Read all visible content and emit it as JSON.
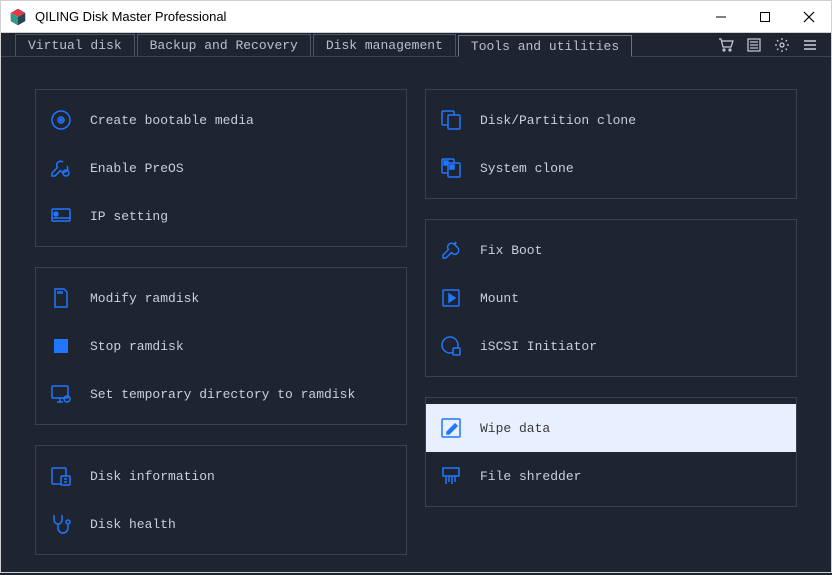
{
  "window": {
    "title": "QILING Disk Master Professional"
  },
  "tabs": {
    "virtual_disk": "Virtual disk",
    "backup_recovery": "Backup and Recovery",
    "disk_management": "Disk management",
    "tools_utilities": "Tools and utilities"
  },
  "left": {
    "group1": {
      "bootable": "Create bootable media",
      "preos": "Enable PreOS",
      "ip": "IP setting"
    },
    "group2": {
      "modify_ramdisk": "Modify ramdisk",
      "stop_ramdisk": "Stop ramdisk",
      "temp_dir": "Set temporary directory to ramdisk"
    },
    "group3": {
      "disk_info": "Disk information",
      "disk_health": "Disk health"
    }
  },
  "right": {
    "group1": {
      "partition_clone": "Disk/Partition clone",
      "system_clone": "System clone"
    },
    "group2": {
      "fix_boot": "Fix Boot",
      "mount": "Mount",
      "iscsi": "iSCSI Initiator"
    },
    "group3": {
      "wipe": "Wipe data",
      "shredder": "File shredder"
    }
  },
  "colors": {
    "accent": "#2176ff",
    "selected_bg": "#e8f0ff"
  }
}
